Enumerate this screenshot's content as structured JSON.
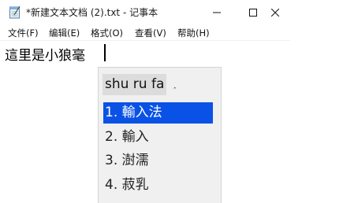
{
  "window": {
    "title": "*新建文本文档 (2).txt - 记事本"
  },
  "menu": {
    "items": [
      "文件(F)",
      "编辑(E)",
      "格式(O)",
      "查看(V)",
      "帮助(H)"
    ]
  },
  "editor": {
    "text": "這里是小狼毫"
  },
  "ime": {
    "composition": "shu ru fa",
    "candidates": [
      {
        "index": "1.",
        "text": "輸入法",
        "selected": true
      },
      {
        "index": "2.",
        "text": "輸入",
        "selected": false
      },
      {
        "index": "3.",
        "text": "澍濡",
        "selected": false
      },
      {
        "index": "4.",
        "text": "菽乳",
        "selected": false
      }
    ]
  },
  "colors": {
    "selection": "#0a52e6",
    "ime_background": "#f0f0f0"
  }
}
